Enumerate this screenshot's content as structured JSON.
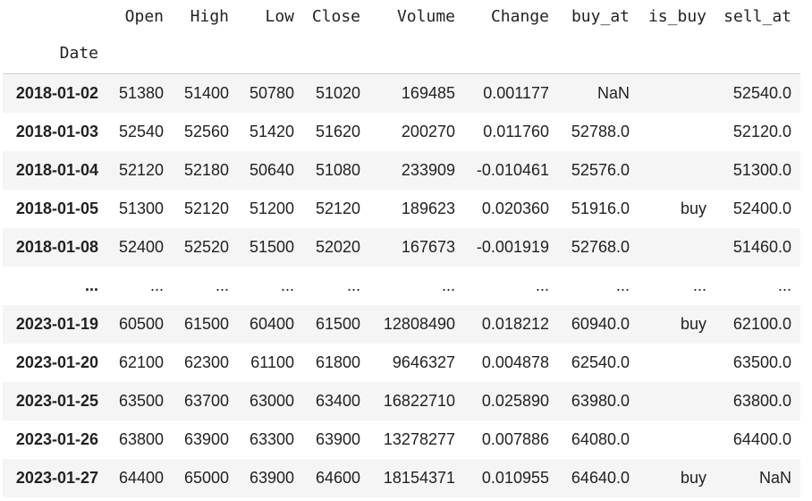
{
  "columns": [
    "Open",
    "High",
    "Low",
    "Close",
    "Volume",
    "Change",
    "buy_at",
    "is_buy",
    "sell_at"
  ],
  "index_name": "Date",
  "rows": [
    {
      "date": "2018-01-02",
      "cells": [
        "51380",
        "51400",
        "50780",
        "51020",
        "169485",
        "0.001177",
        "NaN",
        "",
        "52540.0"
      ]
    },
    {
      "date": "2018-01-03",
      "cells": [
        "52540",
        "52560",
        "51420",
        "51620",
        "200270",
        "0.011760",
        "52788.0",
        "",
        "52120.0"
      ]
    },
    {
      "date": "2018-01-04",
      "cells": [
        "52120",
        "52180",
        "50640",
        "51080",
        "233909",
        "-0.010461",
        "52576.0",
        "",
        "51300.0"
      ]
    },
    {
      "date": "2018-01-05",
      "cells": [
        "51300",
        "52120",
        "51200",
        "52120",
        "189623",
        "0.020360",
        "51916.0",
        "buy",
        "52400.0"
      ]
    },
    {
      "date": "2018-01-08",
      "cells": [
        "52400",
        "52520",
        "51500",
        "52020",
        "167673",
        "-0.001919",
        "52768.0",
        "",
        "51460.0"
      ]
    },
    {
      "date": "...",
      "cells": [
        "...",
        "...",
        "...",
        "...",
        "...",
        "...",
        "...",
        "...",
        "..."
      ]
    },
    {
      "date": "2023-01-19",
      "cells": [
        "60500",
        "61500",
        "60400",
        "61500",
        "12808490",
        "0.018212",
        "60940.0",
        "buy",
        "62100.0"
      ]
    },
    {
      "date": "2023-01-20",
      "cells": [
        "62100",
        "62300",
        "61100",
        "61800",
        "9646327",
        "0.004878",
        "62540.0",
        "",
        "63500.0"
      ]
    },
    {
      "date": "2023-01-25",
      "cells": [
        "63500",
        "63700",
        "63000",
        "63400",
        "16822710",
        "0.025890",
        "63980.0",
        "",
        "63800.0"
      ]
    },
    {
      "date": "2023-01-26",
      "cells": [
        "63800",
        "63900",
        "63300",
        "63900",
        "13278277",
        "0.007886",
        "64080.0",
        "",
        "64400.0"
      ]
    },
    {
      "date": "2023-01-27",
      "cells": [
        "64400",
        "65000",
        "63900",
        "64600",
        "18154371",
        "0.010955",
        "64640.0",
        "buy",
        "NaN"
      ]
    }
  ]
}
